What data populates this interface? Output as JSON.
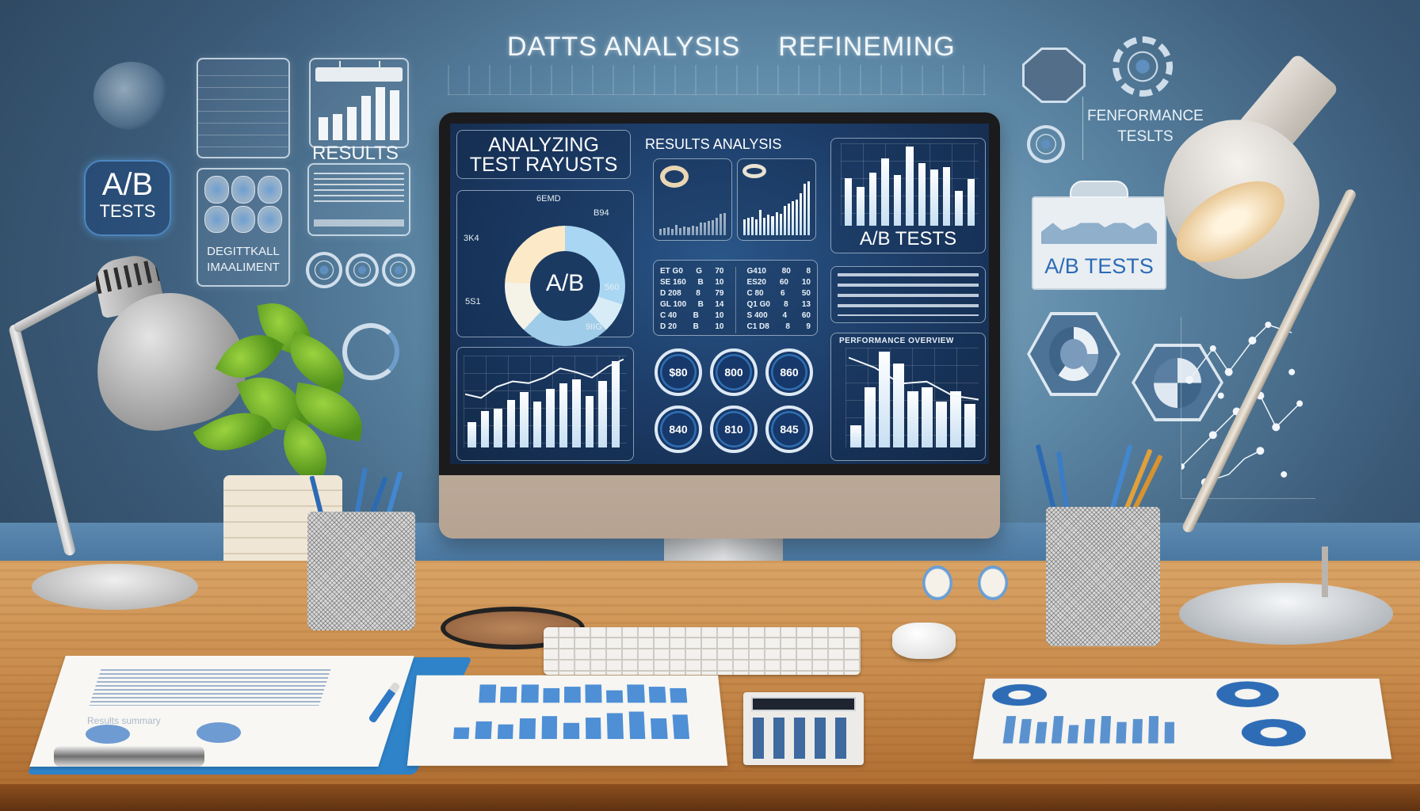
{
  "scene": {
    "description": "Office desk workspace illustration with a monitor displaying an A/B testing analytics dashboard",
    "colors": {
      "wall": "#3a5a78",
      "screen_bg": "#1c3b66",
      "desk_wood": "#c98c4d",
      "accent_blue": "#2c6bb5",
      "clipboard_blue": "#2f83c9"
    }
  },
  "wall": {
    "headline": [
      "DATTS ANALYSIS",
      "REFINEMING"
    ],
    "left_badge": {
      "line1": "A/B",
      "line2": "TESTS"
    },
    "list_panel_rows": [
      "",
      "",
      "",
      "",
      "",
      "",
      "",
      ""
    ],
    "grid_panel_label": [
      "DEGITTKALL",
      "IMAALIMENT"
    ],
    "results_panel_title": "RESULTS",
    "right_label": [
      "FENFORMANCE",
      "TESLTS"
    ],
    "clip_panel_label": "A/B TESTS"
  },
  "monitor": {
    "header_title": [
      "ANALYZING",
      "TEST RAYUSTS"
    ],
    "results_title": "RESULTS ANALYSIS",
    "donut": {
      "center_label": "A/B",
      "segments": [
        "light-blue",
        "pale-blue",
        "sky-blue",
        "cream",
        "peach"
      ],
      "tick_labels": [
        "6EMD",
        "B94",
        "560",
        "9IIG",
        "3K4",
        "5S1"
      ]
    },
    "top_right_chart": {
      "title": "A/B TESTS",
      "bar_values": [
        0.58,
        0.47,
        0.64,
        0.82,
        0.62,
        0.96,
        0.76,
        0.68,
        0.71,
        0.42,
        0.57
      ]
    },
    "mini_chart_bars": [
      0.28,
      0.3,
      0.32,
      0.28,
      0.45,
      0.3,
      0.36,
      0.34,
      0.4,
      0.38,
      0.52,
      0.55,
      0.6,
      0.62,
      0.74,
      0.9,
      0.94
    ],
    "bottom_left_chart": {
      "bar_values": [
        0.28,
        0.4,
        0.42,
        0.52,
        0.6,
        0.5,
        0.64,
        0.7,
        0.74,
        0.56,
        0.72,
        0.94
      ],
      "trend_values": [
        0.58,
        0.54,
        0.66,
        0.72,
        0.7,
        0.76,
        0.86,
        0.82,
        0.76,
        0.88,
        0.96
      ]
    },
    "kpis": [
      "$80",
      "800",
      "860",
      "840",
      "810",
      "845"
    ],
    "table_left": [
      [
        "ET G0",
        "G",
        "70"
      ],
      [
        "SE 160",
        "B",
        "10"
      ],
      [
        "D 208",
        "8",
        "79"
      ],
      [
        "GL 100",
        "B",
        "14"
      ],
      [
        "C 40",
        "B",
        "10"
      ],
      [
        "D 20",
        "B",
        "10"
      ]
    ],
    "table_right": [
      [
        "G410",
        "80",
        "8"
      ],
      [
        "ES20",
        "60",
        "10"
      ],
      [
        "C 80",
        "6",
        "50"
      ],
      [
        "Q1 G0",
        "8",
        "13"
      ],
      [
        "S 400",
        "4",
        "60"
      ],
      [
        "C1 D8",
        "8",
        "9"
      ]
    ],
    "bottom_right_chart": {
      "title": "PERFORMANCE OVERVIEW",
      "bar_values": [
        0.22,
        0.6,
        0.96,
        0.84,
        0.56,
        0.6,
        0.46,
        0.56,
        0.44
      ],
      "trend_values": [
        0.9,
        0.8,
        0.64,
        0.66,
        0.52,
        0.48
      ]
    }
  },
  "desk": {
    "report_caption": "Results summary",
    "calculator_display": ""
  }
}
